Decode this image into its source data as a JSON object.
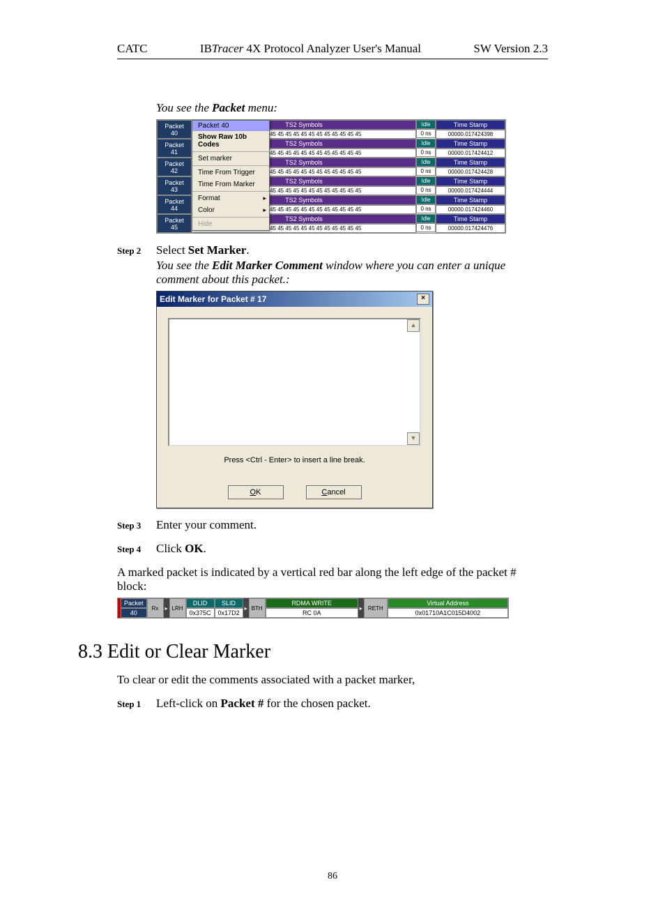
{
  "header": {
    "left": "CATC",
    "center_prefix": "IB",
    "center_italic": "Tracer",
    "center_rest": " 4X Protocol Analyzer User's Manual",
    "right": "SW Version 2.3"
  },
  "caption1_pre": "You see the ",
  "caption1_bold": "Packet",
  "caption1_post": " menu:",
  "menu": {
    "header": "Packet 40",
    "items": [
      "Show Raw 10b Codes",
      "Set marker",
      "Time From Trigger",
      "Time From Marker",
      "Format",
      "Color",
      "Hide"
    ]
  },
  "packets": [
    {
      "num": "40",
      "ts2": "TS2 Symbols",
      "data": "45 45 45 45 45 45 45 45 45 45 45 45 45 45 45",
      "idle": "Idle",
      "idle_v": "0 ns",
      "tstamp": "Time Stamp",
      "tval": "00000.017424398"
    },
    {
      "num": "41",
      "ts2": "TS2 Symbols",
      "data": "45 45 45 45 45 45 45 45 45 45 45 45 45 45 45",
      "idle": "Idle",
      "idle_v": "0 ns",
      "tstamp": "Time Stamp",
      "tval": "00000.017424412"
    },
    {
      "num": "42",
      "ts2": "TS2 Symbols",
      "data": "45 45 45 45 45 45 45 45 45 45 45 45 45 45 45",
      "idle": "Idle",
      "idle_v": "0 ns",
      "tstamp": "Time Stamp",
      "tval": "00000.017424428"
    },
    {
      "num": "43",
      "ts2": "TS2 Symbols",
      "data": "45 45 45 45 45 45 45 45 45 45 45 45 45 45 45",
      "idle": "Idle",
      "idle_v": "0 ns",
      "tstamp": "Time Stamp",
      "tval": "00000.017424444"
    },
    {
      "num": "44",
      "ts2": "TS2 Symbols",
      "data": "45 45 45 45 45 45 45 45 45 45 45 45 45 45 45",
      "idle": "Idle",
      "idle_v": "0 ns",
      "tstamp": "Time Stamp",
      "tval": "00000.017424460"
    },
    {
      "num": "45",
      "ts2": "TS2 Symbols",
      "data": "45 45 45 45 45 45 45 45 45 45 45 45 45 45 45",
      "idle": "Idle",
      "idle_v": "0 ns",
      "tstamp": "Time Stamp",
      "tval": "00000.017424476"
    }
  ],
  "packet_label": "Packet",
  "step2_label": "Step 2",
  "step2_pre": "Select ",
  "step2_bold": "Set Marker",
  "step2_post": ".",
  "caption2_pre": "You see the ",
  "caption2_bold": "Edit Marker Comment",
  "caption2_post": " window where you can enter a unique comment about this packet.:",
  "dialog": {
    "title": "Edit Marker for Packet # 17",
    "close": "×",
    "hint": "Press <Ctrl - Enter> to insert a line break.",
    "ok_u": "O",
    "ok_r": "K",
    "cancel_u": "C",
    "cancel_r": "ancel",
    "scroll_up": "▲",
    "scroll_down": "▼"
  },
  "step3_label": "Step 3",
  "step3_text": "Enter your comment.",
  "step4_label": "Step 4",
  "step4_pre": "Click ",
  "step4_bold": "OK",
  "step4_post": ".",
  "marked_para": "A marked packet is indicated by a vertical red bar along the left edge of the packet # block:",
  "pkt_block": {
    "packet_t": "Packet",
    "packet_v": "40",
    "rx": "Rx",
    "lrh": "LRH",
    "dlid_t": "DLID",
    "dlid_v": "0x375C",
    "slid_t": "SLID",
    "slid_v": "0x17D2",
    "bth": "BTH",
    "rdma_t": "RDMA WRITE",
    "rdma_v": "RC 0A",
    "reth": "RETH",
    "va_t": "Virtual Address",
    "va_v": "0x01710A1C015D4002"
  },
  "section_title": "8.3  Edit or Clear Marker",
  "section_intro": "To clear or edit the comments associated with a packet marker,",
  "step1_label": "Step 1",
  "step1_pre": "Left-click on ",
  "step1_bold": "Packet #",
  "step1_post": " for the chosen packet.",
  "page_num": "86"
}
